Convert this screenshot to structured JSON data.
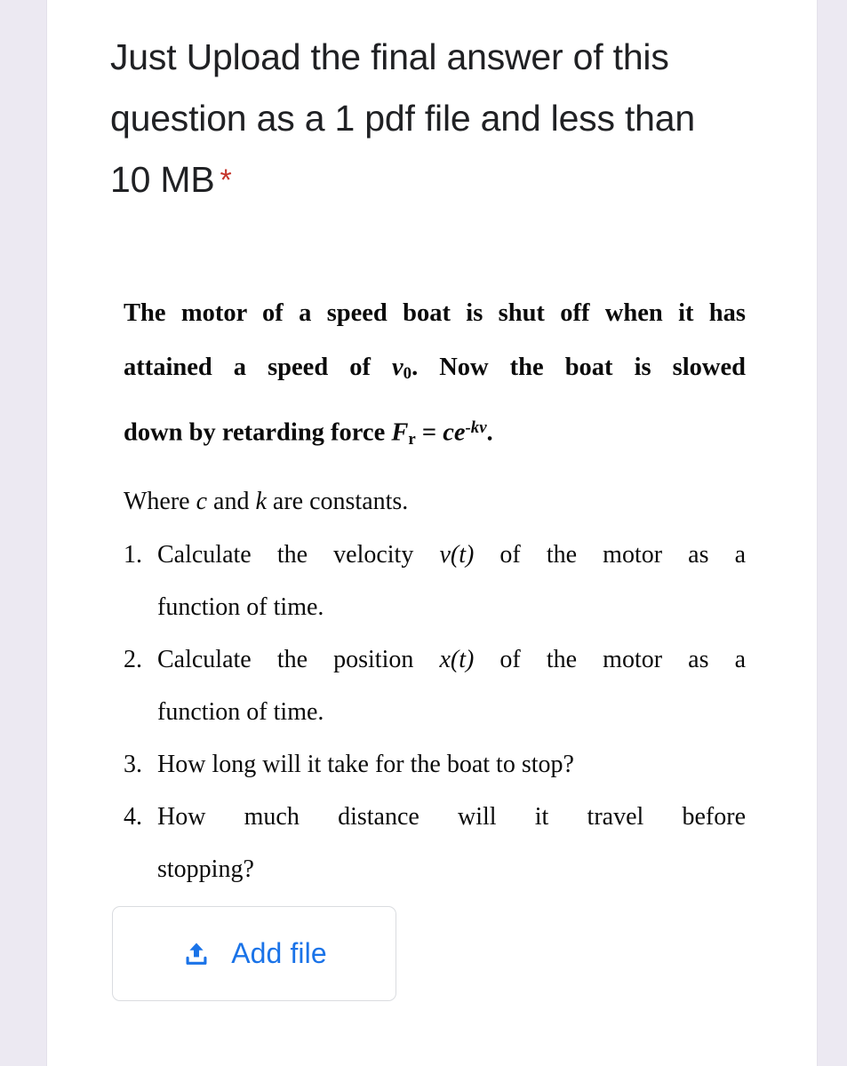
{
  "colors": {
    "page_background": "#ece9f2",
    "card_background": "#ffffff",
    "title_text": "#202124",
    "required_asterisk": "#c5342a",
    "accent_blue": "#1a73e8",
    "button_border": "#dadce0"
  },
  "question": {
    "title": "Just Upload the final answer of this question as a 1 pdf file and less than 10 MB",
    "required_marker": "*"
  },
  "problem": {
    "statement_lines": [
      "The motor of a speed boat is shut off when it has",
      "attained a speed of v₀. Now the boat is slowed",
      "down by retarding force Fᵣ = ce⁻ᵏᵛ."
    ],
    "statement_line1": "The motor of a speed boat is shut off when it has",
    "statement_line2_a": "attained a speed of ",
    "statement_line2_v": "v",
    "statement_line2_sub": "0",
    "statement_line2_b": ". Now the boat is slowed",
    "statement_line3_a": "down by retarding force ",
    "statement_line3_F": "F",
    "statement_line3_Fsub": "r",
    "statement_line3_eq": " = ",
    "statement_line3_ce": "ce",
    "statement_line3_sup": "-kv",
    "statement_line3_end": ".",
    "where_a": "Where ",
    "where_c": "c",
    "where_and": " and ",
    "where_k": "k",
    "where_b": " are constants.",
    "items": [
      {
        "number": "1.",
        "line1_a": "Calculate   the   velocity   ",
        "line1_var": "v(t)",
        "line1_b": "   of   the   motor   as   a",
        "line2": "function of time.",
        "full_text": "Calculate the velocity v(t) of the motor as a function of time."
      },
      {
        "number": "2.",
        "line1_a": "Calculate   the   position   ",
        "line1_var": "x(t)",
        "line1_b": "   of   the   motor   as   a",
        "line2": "function of time.",
        "full_text": "Calculate the position x(t) of the motor as a function of time."
      },
      {
        "number": "3.",
        "single": "How long will it take for the boat to stop?",
        "full_text": "How long will it take for the boat to stop?"
      },
      {
        "number": "4.",
        "line1_a": "How   much   distance   will   it   travel   before",
        "line2": "stopping?",
        "full_text": "How much distance will it travel before stopping?"
      }
    ]
  },
  "add_file": {
    "label": "Add file",
    "icon": "file-upload-icon"
  }
}
